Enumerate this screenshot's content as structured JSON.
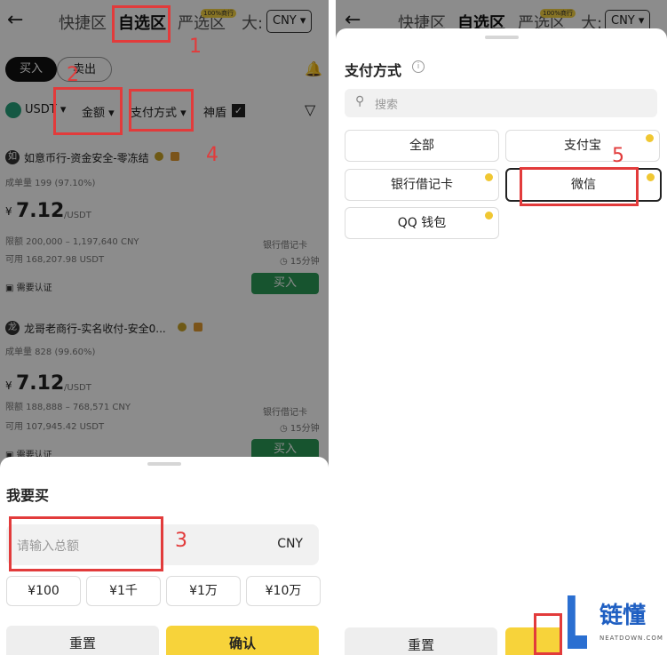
{
  "left": {
    "header": {
      "tabs": [
        "快捷区",
        "自选区",
        "严选区",
        "大:"
      ],
      "badge": "100%商行",
      "currency_btn": "CNY"
    },
    "toggle": {
      "buy": "买入",
      "sell": "卖出"
    },
    "filters": {
      "coin": "USDT",
      "amount": "金额",
      "payment": "支付方式",
      "shield": "神盾"
    },
    "listings": [
      {
        "merchant": "如意币行-资金安全-零冻结",
        "avatar": "如",
        "stats": "成单量 199 (97.10%)",
        "price": "7.12",
        "unit": "/USDT",
        "limit": "限额 200,000 – 1,197,640 CNY",
        "available": "可用 168,207.98 USDT",
        "method": "银行借记卡",
        "time": "15分钟",
        "verify": "需要认证",
        "action": "买入"
      },
      {
        "merchant": "龙哥老商行-实名收付-安全0...",
        "avatar": "龙",
        "stats": "成单量 828 (99.60%)",
        "price": "7.12",
        "unit": "/USDT",
        "limit": "限额 188,888 – 768,571 CNY",
        "available": "可用 107,945.42 USDT",
        "method": "银行借记卡",
        "time": "15分钟",
        "verify": "需要认证",
        "action": "买入"
      }
    ],
    "sheet": {
      "title": "我要买",
      "input_placeholder": "请输入总额",
      "currency": "CNY",
      "quick": [
        "¥100",
        "¥1千",
        "¥1万",
        "¥10万"
      ],
      "reset": "重置",
      "confirm": "确认"
    }
  },
  "right": {
    "header": {
      "tabs": [
        "快捷区",
        "自选区",
        "严选区",
        "大:"
      ],
      "badge": "100%商行",
      "currency_btn": "CNY"
    },
    "sheet": {
      "title": "支付方式",
      "search_placeholder": "搜索",
      "options": [
        "全部",
        "支付宝",
        "银行借记卡",
        "微信",
        "QQ 钱包"
      ],
      "reset": "重置"
    }
  },
  "annotations": [
    "1",
    "2",
    "3",
    "4",
    "5"
  ],
  "watermark": {
    "cn": "链懂",
    "en": "NEATDOWN.COM"
  },
  "colors": {
    "accent_yellow": "#f7d33a",
    "buy_green": "#2a9a57",
    "annotation_red": "#e23b3b"
  }
}
